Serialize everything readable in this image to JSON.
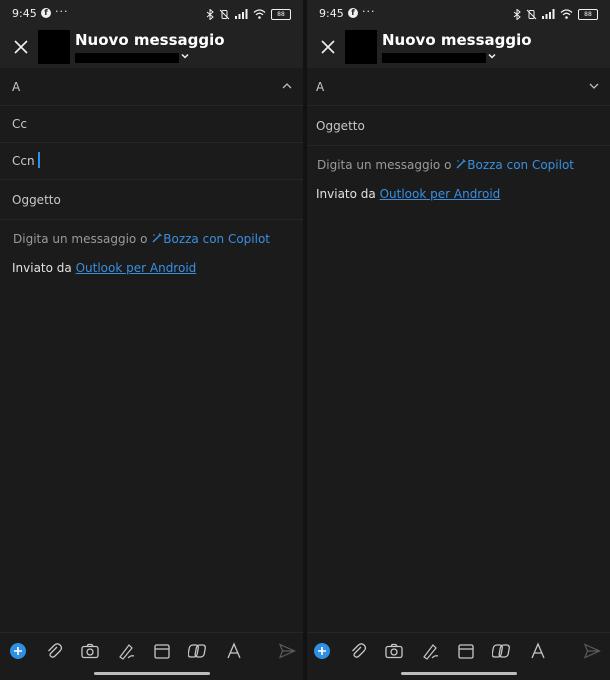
{
  "status": {
    "time": "9:45",
    "fb": "f",
    "dots": "···",
    "battery": "88"
  },
  "left": {
    "header": {
      "title": "Nuovo messaggio"
    },
    "fields": {
      "to": "A",
      "cc": "Cc",
      "bcc": "Ccn",
      "subject": "Oggetto"
    },
    "body": {
      "prompt": "Digita un messaggio o",
      "copilot": "Bozza con Copilot",
      "sig_prefix": "Inviato da",
      "sig_link": "Outlook per Android"
    }
  },
  "right": {
    "header": {
      "title": "Nuovo messaggio"
    },
    "fields": {
      "to": "A",
      "subject": "Oggetto"
    },
    "body": {
      "prompt": "Digita un messaggio o",
      "copilot": "Bozza con Copilot",
      "sig_prefix": "Inviato da",
      "sig_link": "Outlook per Android"
    }
  },
  "colors": {
    "accent": "#3a8fe0",
    "background": "#1b1b1b",
    "header": "#222222"
  },
  "icons": [
    "close-icon",
    "chevron-down-icon",
    "chevron-up-icon",
    "add-icon",
    "attach-icon",
    "camera-icon",
    "pen-icon",
    "calendar-icon",
    "loop-icon",
    "text-format-icon",
    "send-icon"
  ]
}
